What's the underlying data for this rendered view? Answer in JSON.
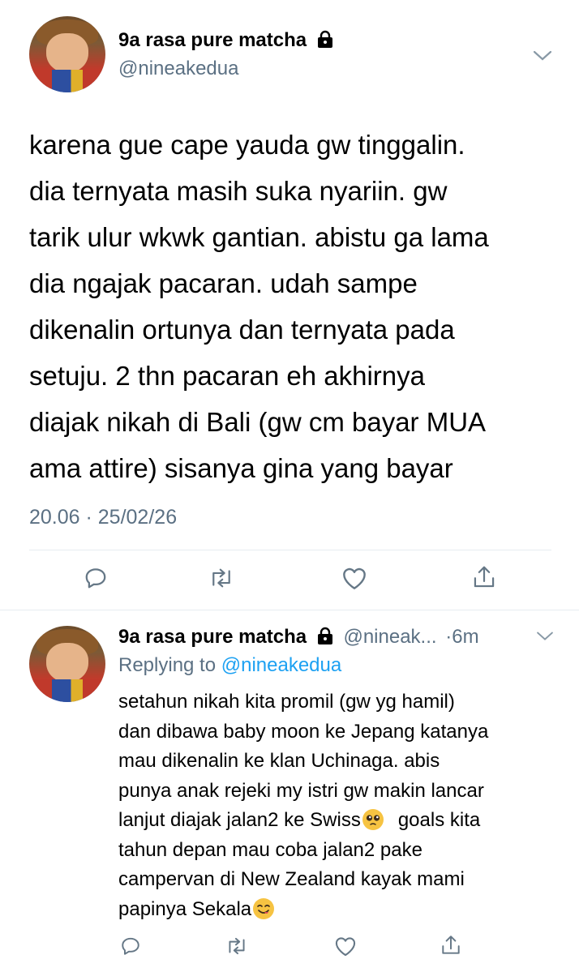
{
  "main_tweet": {
    "display_name": "9a rasa pure matcha",
    "handle": "@nineakedua",
    "lines": [
      "karena gue cape yauda gw tinggalin.",
      "dia ternyata masih suka nyariin. gw",
      "tarik ulur wkwk gantian. abistu ga lama",
      "dia ngajak pacaran. udah sampe",
      "dikenalin ortunya dan ternyata pada",
      "setuju. 2 thn pacaran eh akhirnya",
      "diajak nikah di Bali (gw cm bayar MUA",
      "ama attire) sisanya gina yang bayar"
    ],
    "timestamp": "20.06 · 25/02/26"
  },
  "reply_tweet": {
    "display_name": "9a rasa pure matcha",
    "handle_truncated": "@nineak...",
    "time": "·6m",
    "replying_to_label": "Replying to",
    "replying_to_handle": "@nineakedua",
    "lines": [
      "setahun nikah kita promil (gw yg hamil)",
      "dan dibawa baby moon ke Jepang katanya",
      "mau dikenalin ke klan Uchinaga. abis",
      "punya anak rejeki my istri gw makin lancar",
      "lanjut diajak jalan2 ke Swiss",
      "goals kita",
      "tahun depan mau coba jalan2 pake",
      "campervan di New Zealand kayak mami",
      "papinya Sekala"
    ]
  },
  "icons": [
    "reply-icon",
    "retweet-icon",
    "like-icon",
    "share-icon",
    "chevron-down-icon",
    "lock-icon",
    "pleading-face-emoji",
    "yum-face-emoji"
  ],
  "colors": {
    "text": "#000000",
    "muted": "#5b7083",
    "link": "#1da1f2",
    "divider": "#e6ecf0"
  }
}
